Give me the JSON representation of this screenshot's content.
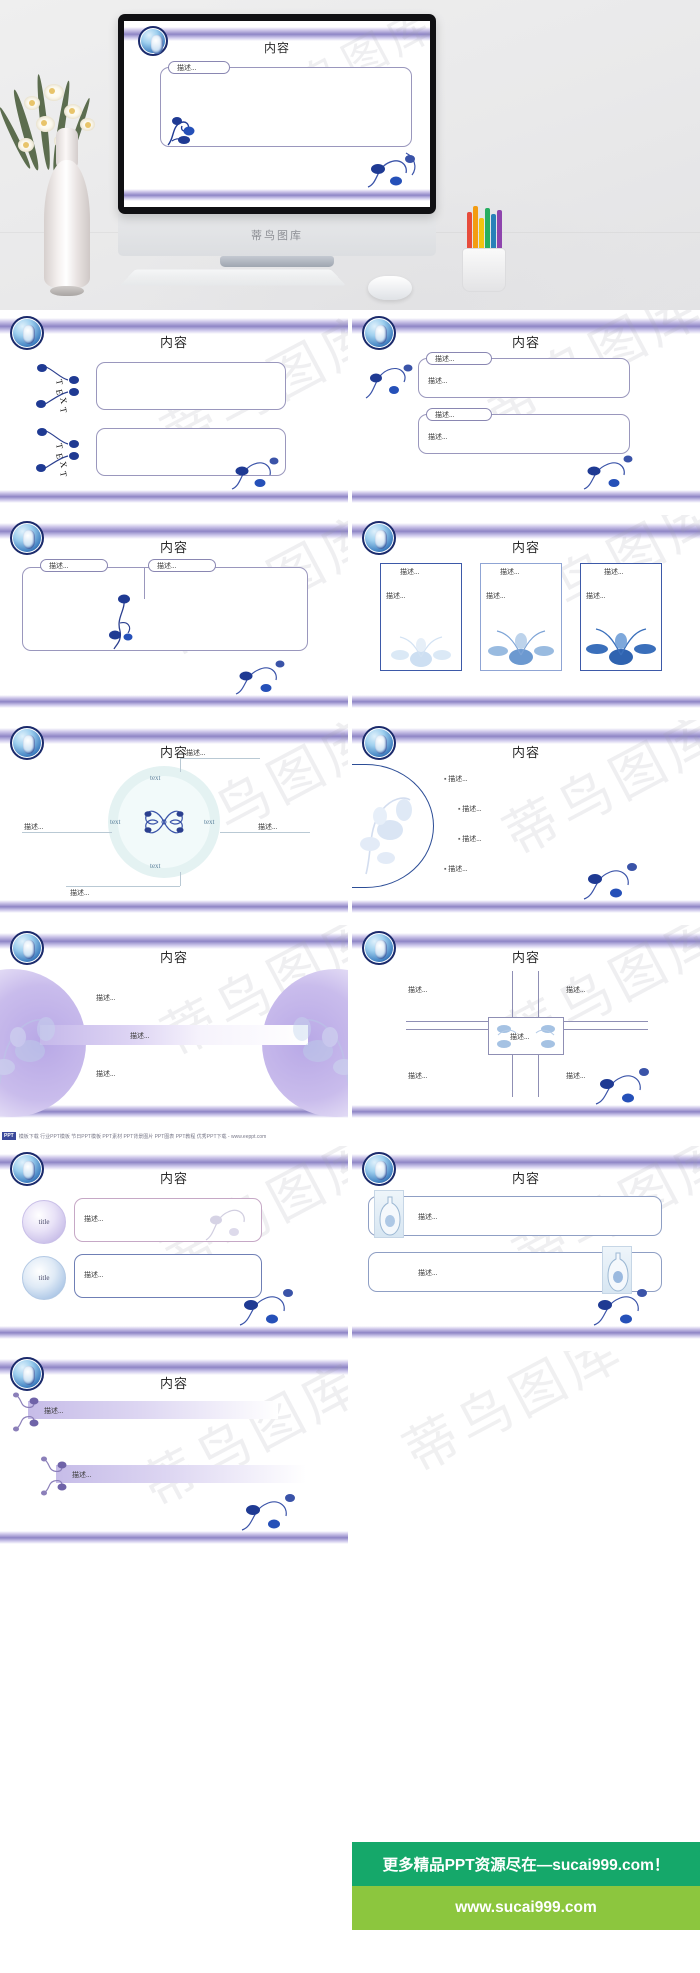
{
  "hero": {
    "monitor_brand": "蒂鸟图库",
    "slide": {
      "title": "内容",
      "tag_label": "描述...",
      "logo_icon": "porcelain-vase-icon",
      "watermark": "蒂鸟图库"
    }
  },
  "common": {
    "title": "内容",
    "desc": "描述...",
    "text": "text",
    "title_word": "title",
    "text_deco": "TEXT",
    "logo_icon": "porcelain-vase-icon",
    "watermark": "蒂鸟图库"
  },
  "colors": {
    "accent_purple": "#8f86c6",
    "porcelain_blue": "#1f3a93",
    "deep_blue": "#1b2a6b",
    "banner_green": "#15a86a",
    "banner_lightgreen": "#8cc63e",
    "ring_teal": "#e4f2f2"
  },
  "slides": [
    {
      "index": 1,
      "name": "two-rounded-boxes",
      "title": "内容",
      "labels": [
        "TEXT",
        "TEXT"
      ],
      "boxes": [
        "",
        ""
      ]
    },
    {
      "index": 2,
      "name": "two-tagged-panels",
      "title": "内容",
      "tags": [
        "描述...",
        "描述..."
      ],
      "bodies": [
        "描述...",
        "描述..."
      ]
    },
    {
      "index": 3,
      "name": "two-tag-single-panel",
      "title": "内容",
      "tags": [
        "描述...",
        "描述..."
      ]
    },
    {
      "index": 4,
      "name": "three-column-cards",
      "title": "内容",
      "cards": [
        {
          "tag": "描述...",
          "body": "描述..."
        },
        {
          "tag": "描述...",
          "body": "描述..."
        },
        {
          "tag": "描述...",
          "body": "描述..."
        }
      ]
    },
    {
      "index": 5,
      "name": "radial-four-point-diagram",
      "title": "内容",
      "nodes": [
        "text",
        "text",
        "text",
        "text"
      ],
      "callouts": [
        "描述...",
        "描述...",
        "描述...",
        "描述..."
      ]
    },
    {
      "index": 6,
      "name": "arc-bullet-list",
      "title": "内容",
      "bullets": [
        "描述...",
        "描述...",
        "描述...",
        "描述..."
      ]
    },
    {
      "index": 7,
      "name": "venn-two-circles",
      "title": "内容",
      "labels": [
        "描述...",
        "描述...",
        "描述..."
      ]
    },
    {
      "index": 8,
      "name": "cross-quadrant-diagram",
      "title": "内容",
      "center": "描述...",
      "labels": [
        "描述...",
        "描述...",
        "描述...",
        "描述..."
      ]
    },
    {
      "index": 9,
      "name": "title-circle-rows",
      "title": "内容",
      "rows": [
        {
          "circle": "title",
          "body": "描述..."
        },
        {
          "circle": "title",
          "body": "描述..."
        }
      ]
    },
    {
      "index": 10,
      "name": "vase-photo-rows",
      "title": "内容",
      "rows": [
        "描述...",
        "描述..."
      ]
    },
    {
      "index": 11,
      "name": "gradient-bars",
      "title": "内容",
      "bars": [
        "描述...",
        "描述..."
      ]
    }
  ],
  "credit": {
    "tag": "PPT",
    "text": "模板下载 行业PPT模板 节日PPT模板 PPT素材 PPT背景图片 PPT图表 PPT教程 优秀PPT下载 - www.eeppt.com"
  },
  "promo": {
    "line1": "更多精品PPT资源尽在—sucai999.com！",
    "line2": "www.sucai999.com"
  }
}
